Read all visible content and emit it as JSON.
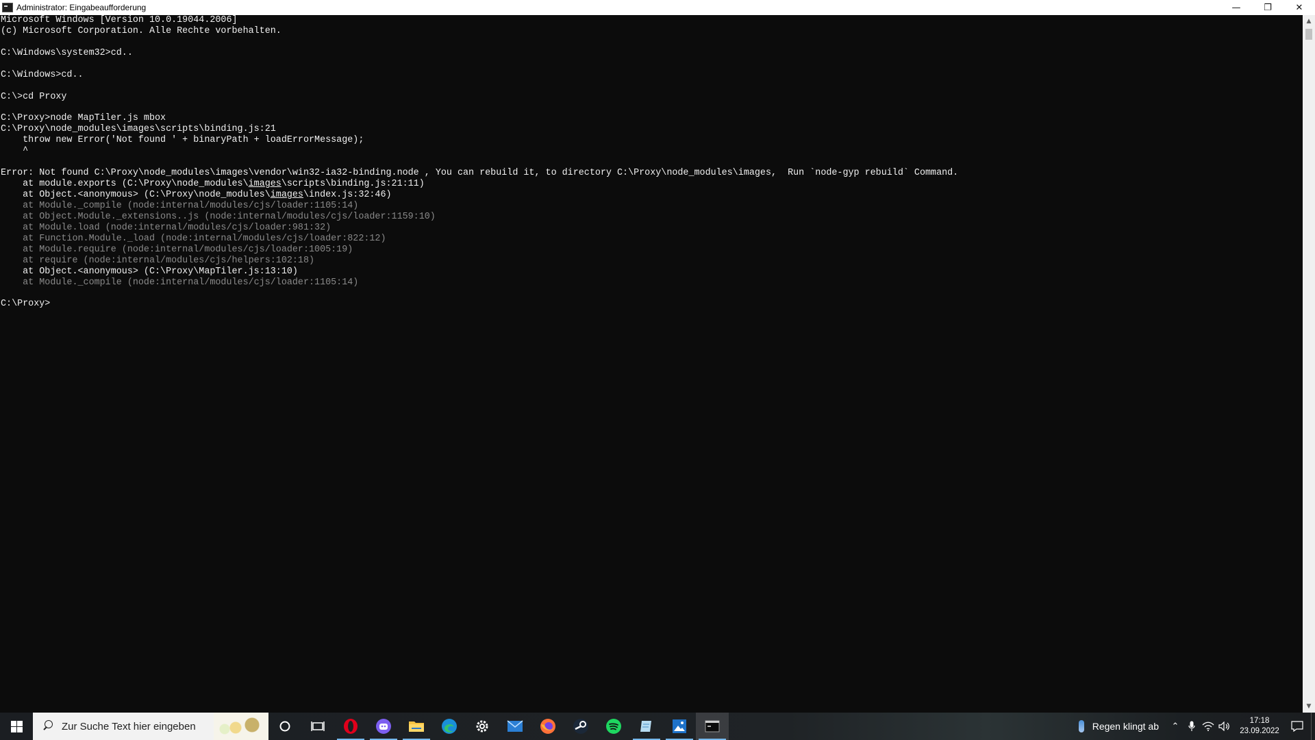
{
  "window": {
    "title": "Administrator: Eingabeaufforderung",
    "minimize_glyph": "—",
    "restore_glyph": "❐",
    "close_glyph": "✕"
  },
  "console": {
    "lines": [
      "Microsoft Windows [Version 10.0.19044.2006]",
      "(c) Microsoft Corporation. Alle Rechte vorbehalten.",
      "",
      "C:\\Windows\\system32>cd..",
      "",
      "C:\\Windows>cd..",
      "",
      "C:\\>cd Proxy",
      "",
      "C:\\Proxy>node MapTiler.js mbox",
      "C:\\Proxy\\node_modules\\images\\scripts\\binding.js:21",
      "    throw new Error('Not found ' + binaryPath + loadErrorMessage);",
      "    ^",
      "",
      "Error: Not found C:\\Proxy\\node_modules\\images\\vendor\\win32-ia32-binding.node , You can rebuild it, to directory C:\\Proxy\\node_modules\\images,  Run `node-gyp rebuild` Command.",
      "    at module.exports (C:\\Proxy\\node_modules\\images\\scripts\\binding.js:21:11)",
      "    at Object.<anonymous> (C:\\Proxy\\node_modules\\images\\index.js:32:46)",
      "    at Module._compile (node:internal/modules/cjs/loader:1105:14)",
      "    at Object.Module._extensions..js (node:internal/modules/cjs/loader:1159:10)",
      "    at Module.load (node:internal/modules/cjs/loader:981:32)",
      "    at Function.Module._load (node:internal/modules/cjs/loader:822:12)",
      "    at Module.require (node:internal/modules/cjs/loader:1005:19)",
      "    at require (node:internal/modules/cjs/helpers:102:18)",
      "    at Object.<anonymous> (C:\\Proxy\\MapTiler.js:13:10)",
      "    at Module._compile (node:internal/modules/cjs/loader:1105:14)",
      "",
      "C:\\Proxy>"
    ],
    "trace1_prefix": "    at module.exports (C:\\Proxy\\node_modules\\",
    "trace1_link": "images",
    "trace1_suffix": "\\scripts\\binding.js:21:11)",
    "trace2_prefix": "    at Object.<anonymous> (C:\\Proxy\\node_modules\\",
    "trace2_link": "images",
    "trace2_suffix": "\\index.js:32:46)"
  },
  "taskbar": {
    "search_placeholder": "Zur Suche Text hier eingeben",
    "weather_text": "Regen klingt ab",
    "clock_time": "17:18",
    "clock_date": "23.09.2022",
    "pinned": [
      "cortana",
      "task-view",
      "opera",
      "discord",
      "file-explorer",
      "edge",
      "settings",
      "mail",
      "firefox",
      "steam",
      "spotify",
      "notepad",
      "photos",
      "command-prompt"
    ]
  },
  "colors": {
    "console_bg": "#0c0c0c",
    "console_text": "#f0f0f0",
    "console_dim": "#8a8a8a",
    "taskbar_accent": "#76b9ed"
  }
}
